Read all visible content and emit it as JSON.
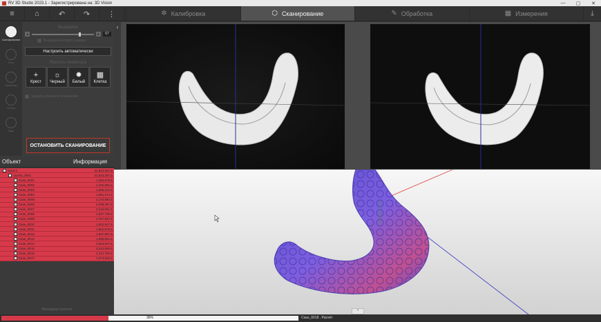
{
  "window": {
    "title": "RV 3D Studio 2023.1 - Зарегистрирована на: 3D Vision",
    "controls": [
      "—",
      "▢",
      "✕"
    ]
  },
  "toolbar": {
    "icons": [
      "menu-icon",
      "home-icon",
      "undo-icon",
      "redo-icon",
      "more-icon"
    ],
    "glyphs": [
      "≡",
      "⌂",
      "↶",
      "↷",
      "⋮"
    ],
    "tabs": [
      {
        "label": "Калибровка",
        "icon": "✲",
        "active": false
      },
      {
        "label": "Сканирование",
        "icon": "⬡",
        "active": true
      },
      {
        "label": "Обработка",
        "icon": "✎",
        "active": false
      },
      {
        "label": "Измерения",
        "icon": "▦",
        "active": false
      }
    ],
    "right_icon": "⤓"
  },
  "rail": {
    "items": [
      {
        "label": "Сканирование",
        "active": true
      },
      {
        "label": "Угол",
        "active": false
      },
      {
        "label": "Проектор",
        "active": false
      },
      {
        "label": "Стенд",
        "active": false
      },
      {
        "label": "Вид",
        "active": false
      }
    ]
  },
  "settings": {
    "exposure_title": "Выдержка",
    "exposure_minus": "◂",
    "exposure_plus": "▸",
    "exposure_value": "67",
    "exposure_level": 0.75,
    "hdr_label": "Выдержка второго снимка",
    "auto_button": "Настроить автоматически",
    "projector_title": "Яркость проектора",
    "patterns": [
      {
        "label": "Крест",
        "glyph": "+"
      },
      {
        "label": "Черный",
        "glyph": "☼"
      },
      {
        "label": "Белый",
        "glyph": "✹"
      },
      {
        "label": "Клетка",
        "glyph": "▦"
      }
    ],
    "filter_label": "Удалить фоновое освещение",
    "stop_button": "ОСТАНОВИТЬ СКАНИРОВАНИЕ",
    "collapse_glyph": "‹"
  },
  "tree": {
    "col_object": "Объект",
    "col_info": "Информация",
    "rows": [
      {
        "name": "Зона 0",
        "value": "31,923,367 Δ",
        "indent": 0
      },
      {
        "name": "группа_0001",
        "value": "31,923,367 Δ",
        "indent": 1
      },
      {
        "name": "Скан_0001",
        "value": "1,294,575 Δ",
        "indent": 2
      },
      {
        "name": "Скан_0002",
        "value": "1,422,061 Δ",
        "indent": 2
      },
      {
        "name": "Скан_0003",
        "value": "1,685,312 Δ",
        "indent": 2
      },
      {
        "name": "Скан_0004",
        "value": "1,951,374 Δ",
        "indent": 2
      },
      {
        "name": "Скан_0005",
        "value": "2,170,994 Δ",
        "indent": 2
      },
      {
        "name": "Скан_0006",
        "value": "2,298,487 Δ",
        "indent": 2
      },
      {
        "name": "Скан_0007",
        "value": "2,216,941 Δ",
        "indent": 2
      },
      {
        "name": "Скан_0008",
        "value": "1,927,735 Δ",
        "indent": 2
      },
      {
        "name": "Скан_0009",
        "value": "1,757,847 Δ",
        "indent": 2
      },
      {
        "name": "Скан_0010",
        "value": "1,602,917 Δ",
        "indent": 2
      },
      {
        "name": "Скан_0011",
        "value": "1,661,679 Δ",
        "indent": 2
      },
      {
        "name": "Скан_0012",
        "value": "1,697,907 Δ",
        "indent": 2
      },
      {
        "name": "Скан_0013",
        "value": "1,898,564 Δ",
        "indent": 2
      },
      {
        "name": "Скан_0014",
        "value": "2,053,627 Δ",
        "indent": 2
      },
      {
        "name": "Скан_0015",
        "value": "2,242,948 Δ",
        "indent": 2
      },
      {
        "name": "Скан_0016",
        "value": "2,214,763 Δ",
        "indent": 2
      },
      {
        "name": "Скан_0017",
        "value": "1,873,945 Δ",
        "indent": 2
      }
    ],
    "footer": "Менеджер проекта"
  },
  "viewport": {
    "expand_glyph": "⌃"
  },
  "status": {
    "progress_text": "36%",
    "progress": 0.36,
    "message": "Скан_0018 . Расчёт"
  },
  "colors": {
    "accent": "#d63a4a",
    "mesh": "#6a5ad6",
    "active_tab": "#525252"
  }
}
